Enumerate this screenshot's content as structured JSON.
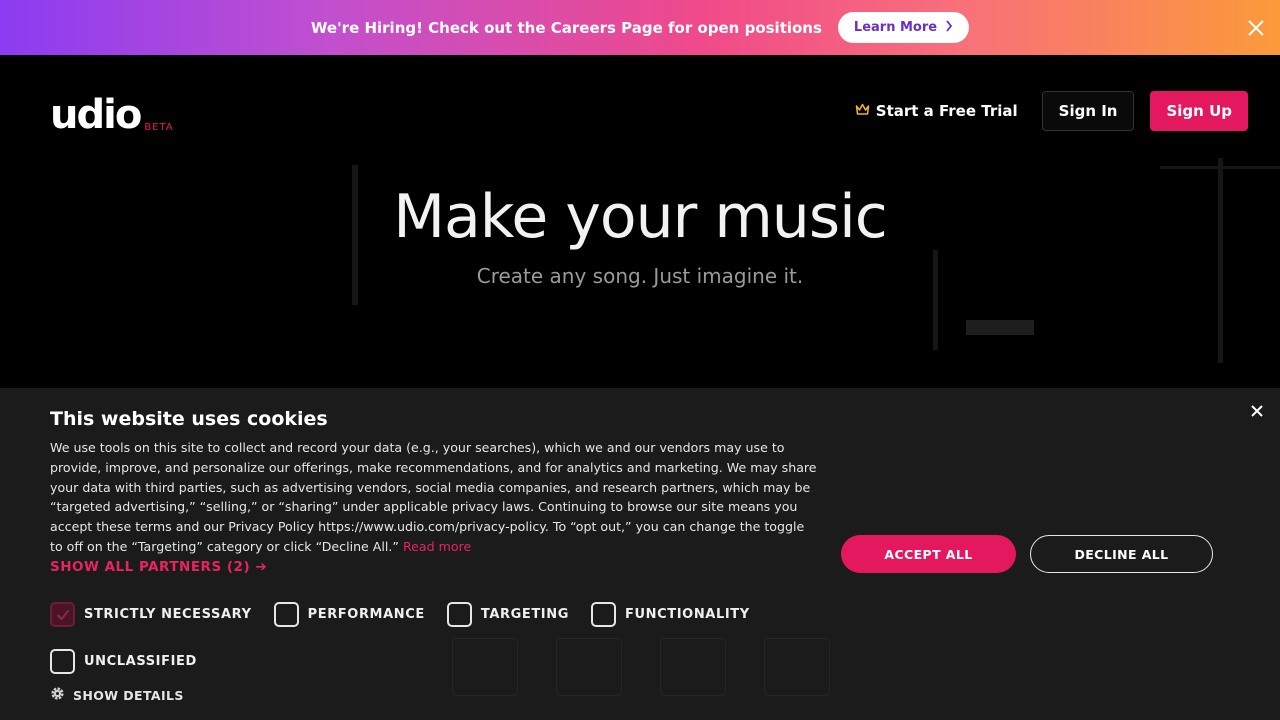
{
  "banner": {
    "text": "We're Hiring! Check out the Careers Page for open positions",
    "button_label": "Learn More",
    "button_icon": "chevron-right-icon",
    "close_icon": "close-icon"
  },
  "header": {
    "logo": "udio",
    "logo_badge": "BETA",
    "trial_label": "Start a Free Trial",
    "trial_icon": "crown-icon",
    "signin_label": "Sign In",
    "signup_label": "Sign Up"
  },
  "hero": {
    "title": "Make your music",
    "subtitle": "Create any song. Just imagine it."
  },
  "cookie": {
    "title": "This website uses cookies",
    "body": "We use tools on this site to collect and record your data (e.g., your searches), which we and our vendors may use to provide, improve, and personalize our offerings, make recommendations, and for analytics and marketing. We may share your data with third parties, such as advertising vendors, social media companies, and research partners, which may be “targeted advertising,” “selling,” or “sharing” under applicable privacy laws. Continuing to browse our site means you accept these terms and our Privacy Policy https://www.udio.com/privacy-policy. To “opt out,” you can change the toggle to off on the “Targeting” category or click “Decline All.”",
    "read_more": "Read more",
    "show_partners": "SHOW ALL PARTNERS (2) ➔",
    "categories": [
      {
        "label": "STRICTLY NECESSARY",
        "checked": true
      },
      {
        "label": "PERFORMANCE",
        "checked": false
      },
      {
        "label": "TARGETING",
        "checked": false
      },
      {
        "label": "FUNCTIONALITY",
        "checked": false
      },
      {
        "label": "UNCLASSIFIED",
        "checked": false
      }
    ],
    "show_details": "SHOW DETAILS",
    "accept_label": "ACCEPT ALL",
    "decline_label": "DECLINE ALL"
  },
  "colors": {
    "accent": "#e3185e",
    "panel": "#1b1b1c",
    "background": "#000000"
  }
}
